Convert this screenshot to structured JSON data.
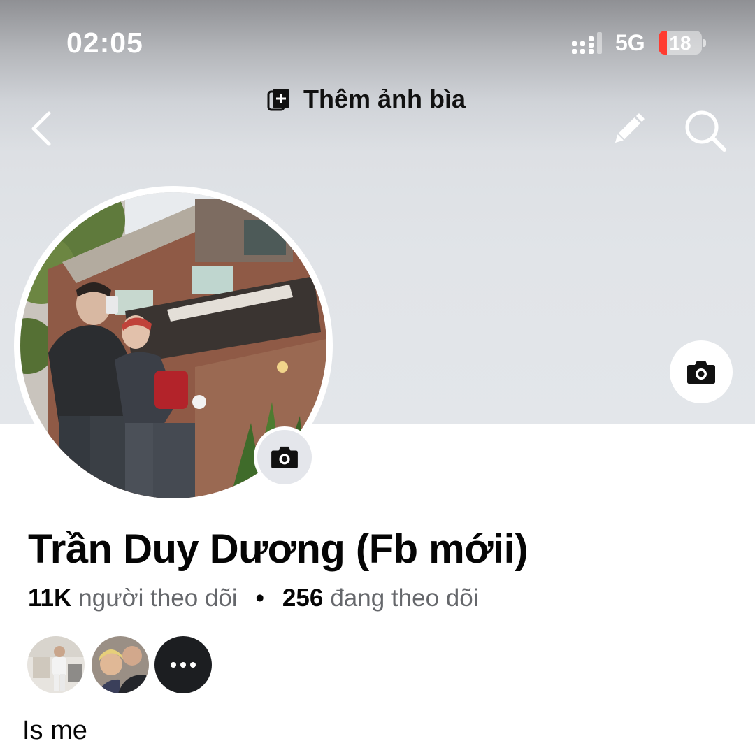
{
  "status_bar": {
    "time": "02:05",
    "network": "5G",
    "battery_level": "18"
  },
  "top_bar": {
    "add_cover_label": "Thêm ảnh bìa",
    "back_icon": "chevron-left-icon",
    "edit_icon": "pencil-icon",
    "search_icon": "search-icon"
  },
  "profile": {
    "name": "Trần Duy Dương (Fb mớii)",
    "followers_count": "11K",
    "followers_label": "người theo dõi",
    "separator": "•",
    "following_count": "256",
    "following_label": "đang theo dõi",
    "bio": "Is me"
  },
  "colors": {
    "primary_text": "#050505",
    "secondary_text": "#65676b",
    "cover_background": "#e1e4e8",
    "camera_button_bg": "#e4e6eb",
    "battery_low": "#ff3b30"
  }
}
